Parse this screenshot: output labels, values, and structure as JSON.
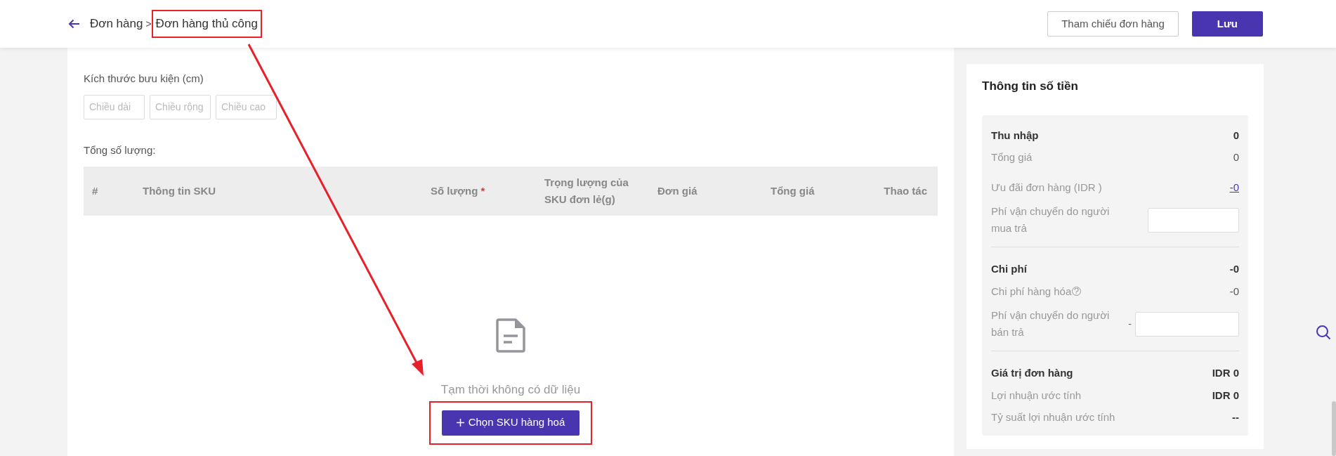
{
  "header": {
    "breadcrumb": [
      "Đơn hàng",
      "Đơn hàng thủ công"
    ],
    "separator": ">",
    "buttons": [
      {
        "label": "Tham chiếu đơn hàng",
        "kind": "secondary"
      },
      {
        "label": "Lưu",
        "kind": "primary"
      }
    ]
  },
  "parcel": {
    "label": "Kích thước bưu kiện (cm)",
    "fields": [
      {
        "placeholder": "Chiều dài"
      },
      {
        "placeholder": "Chiều rộng"
      },
      {
        "placeholder": "Chiều cao"
      }
    ]
  },
  "total_quantity": {
    "label": "Tổng số lượng:"
  },
  "table": {
    "columns": [
      {
        "label": "#",
        "required": false
      },
      {
        "label": "Thông tin SKU",
        "required": false
      },
      {
        "label": "Số lượng",
        "required": true
      },
      {
        "label": "Trọng lượng của SKU đơn lẻ(g)",
        "required": false
      },
      {
        "label": "Đơn giá",
        "required": false
      },
      {
        "label": "Tổng giá",
        "required": false
      },
      {
        "label": "Thao tác",
        "required": false
      }
    ],
    "required_mark": "*"
  },
  "empty_state": {
    "message": "Tạm thời không có dữ liệu",
    "button": "Chọn SKU hàng hoá"
  },
  "summary": {
    "title": "Thông tin số tiền",
    "sections": [
      [
        {
          "kind": "heading",
          "label": "Thu nhập",
          "value": "0"
        },
        {
          "kind": "item",
          "label": "Tổng giá",
          "value": "0"
        },
        {
          "kind": "link",
          "label": "Ưu đãi đơn hàng (IDR )",
          "value": "-0"
        },
        {
          "kind": "field",
          "label": "Phí vận chuyển do người mua trả"
        }
      ],
      [
        {
          "kind": "heading",
          "label": "Chi phí",
          "value": "-0"
        },
        {
          "kind": "item",
          "label": "Chi phí hàng hóa",
          "value": "-0",
          "help": true
        },
        {
          "kind": "field",
          "label": "Phí vận chuyển do người bán trả",
          "prefix": "-"
        }
      ],
      [
        {
          "kind": "heading",
          "label": "Giá trị đơn hàng",
          "value": "IDR 0"
        },
        {
          "kind": "metric",
          "label": "Lợi nhuận ước tính",
          "value": "IDR 0"
        },
        {
          "kind": "metric",
          "label": "Tỷ suất lợi nhuận ước tính",
          "value": "--"
        }
      ]
    ]
  }
}
